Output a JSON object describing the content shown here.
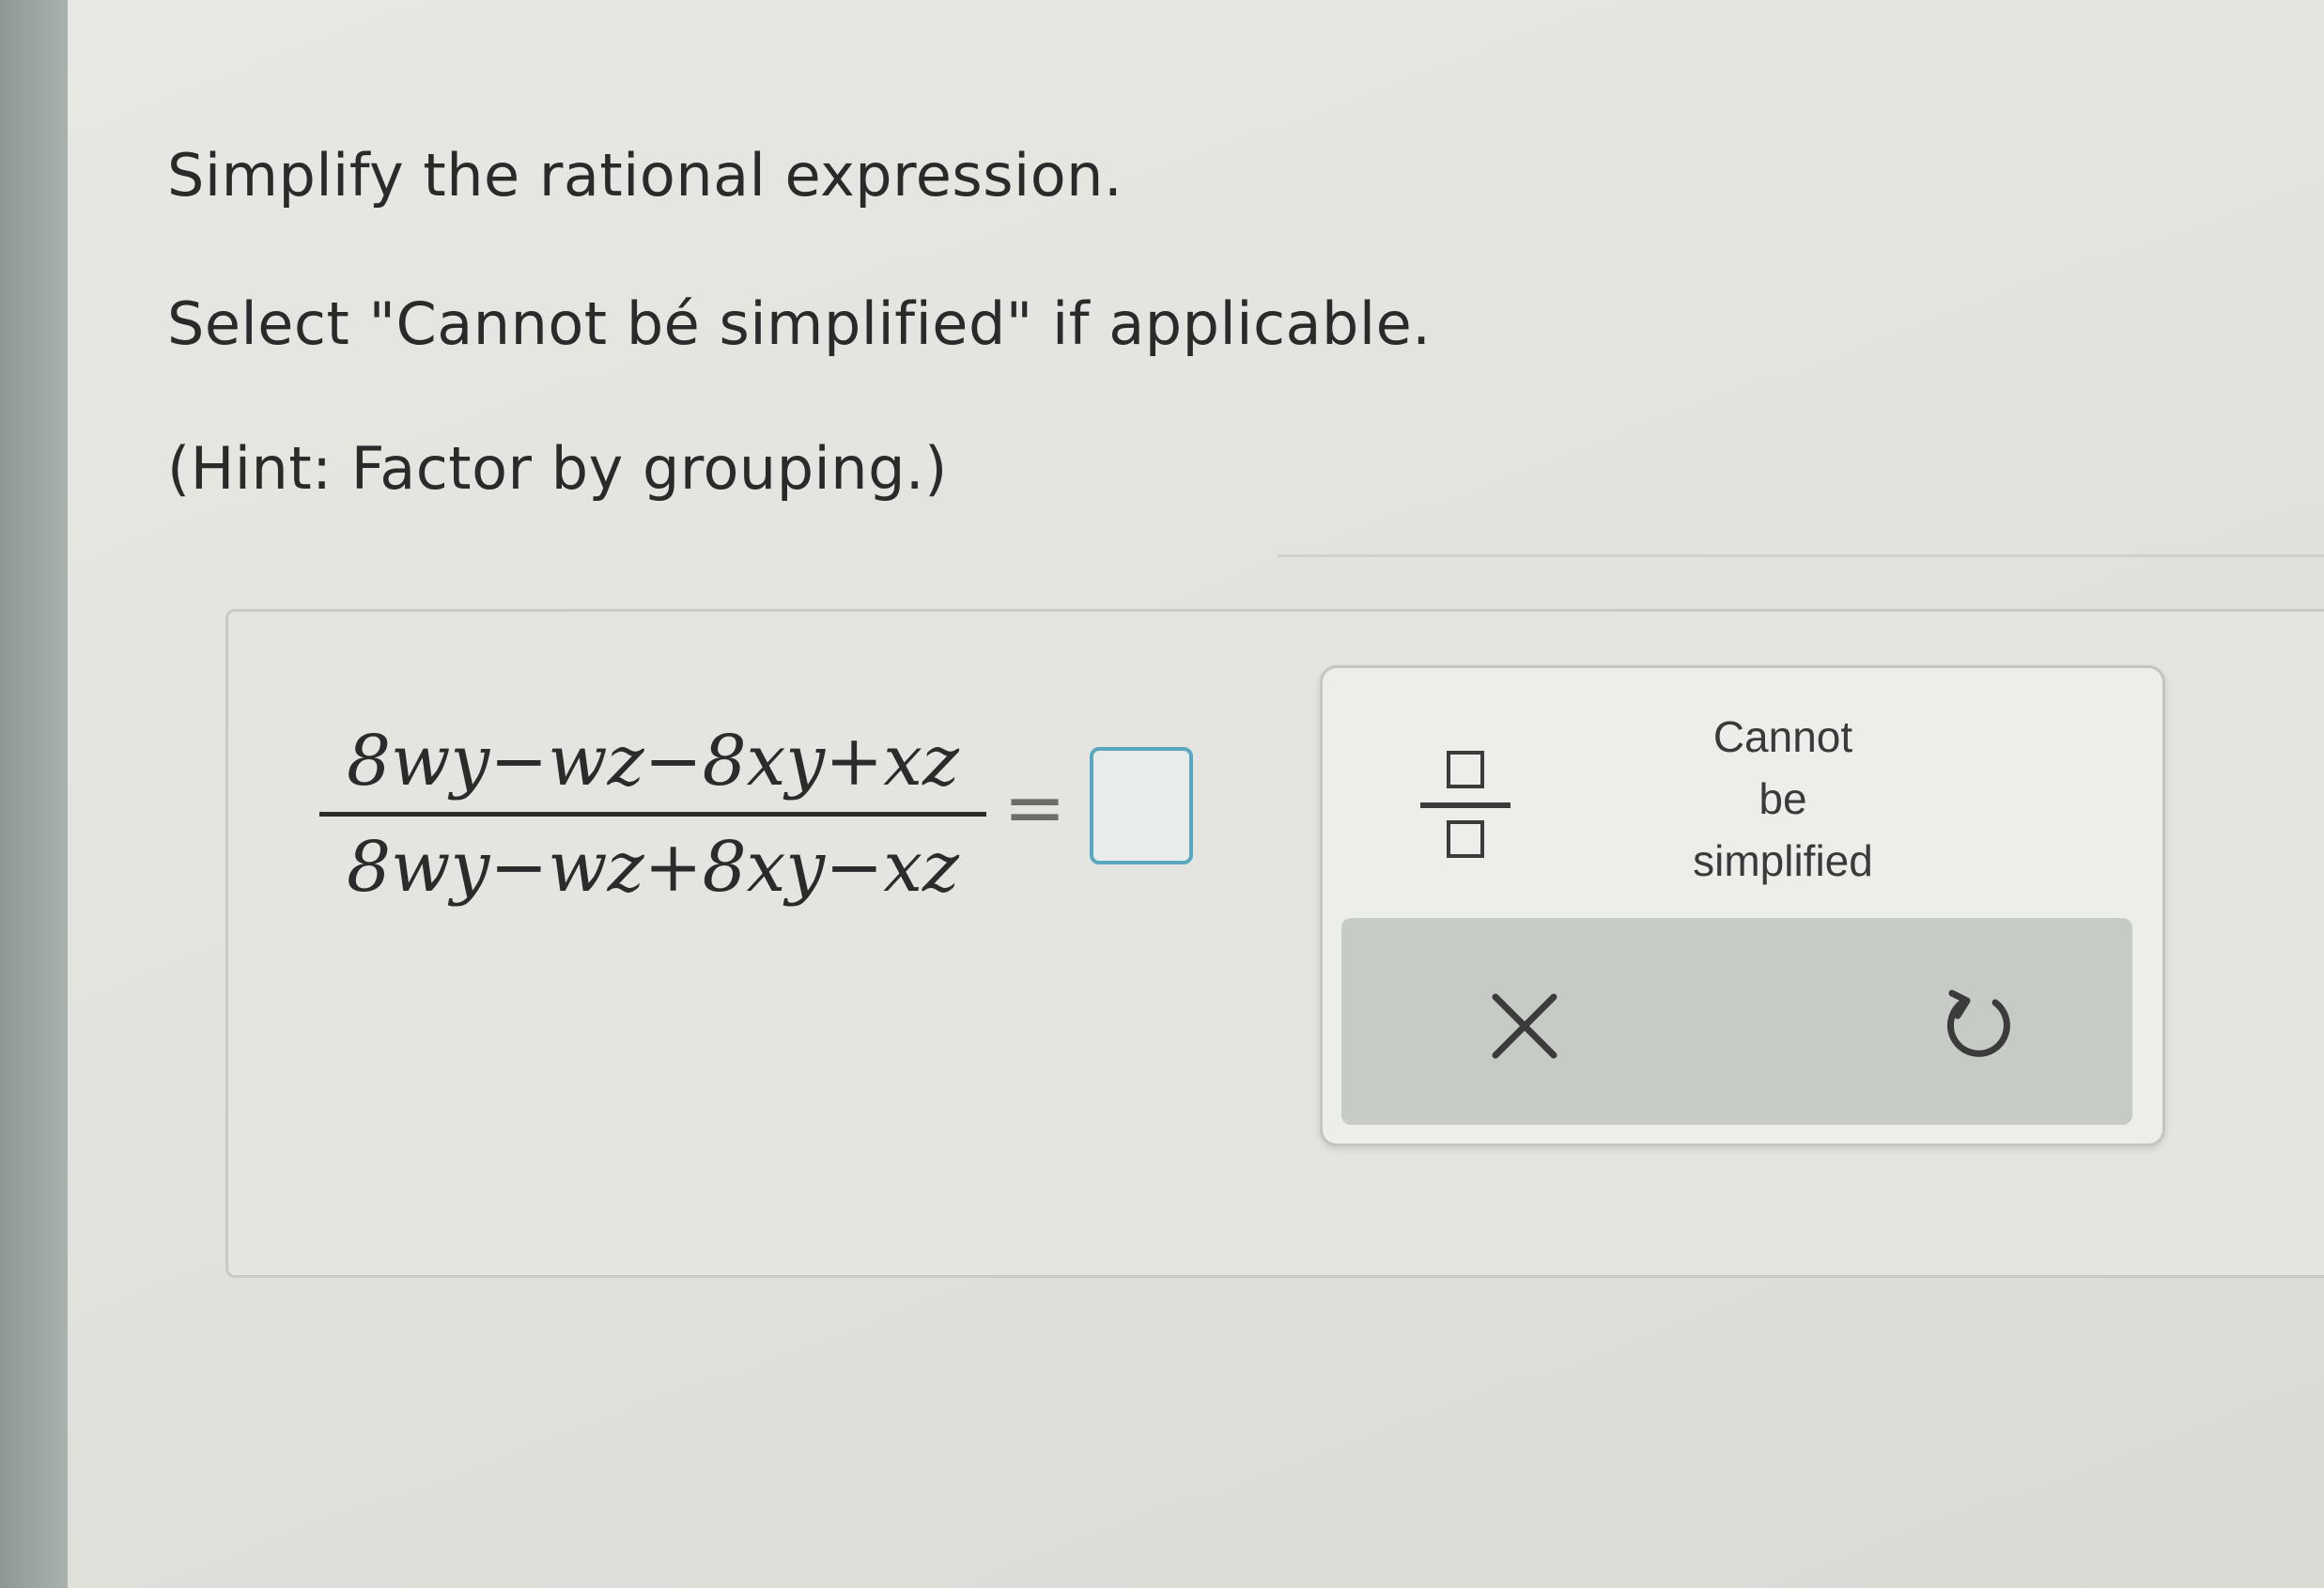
{
  "question": {
    "line1": "Simplify the rational expression.",
    "line2": "Select \"Cannot bé simplified\" if applicable.",
    "line3": "(Hint: Factor by grouping.)"
  },
  "expression": {
    "numerator": "8wy−wz−8xy+xz",
    "denominator": "8wy−wz+8xy−xz",
    "equals": "="
  },
  "answer": {
    "value": ""
  },
  "keypad": {
    "fraction_icon": "fraction-template-icon",
    "cannot_label": "Cannot\nbe\nsimplified",
    "clear_icon": "x-icon",
    "undo_icon": "undo-icon"
  },
  "colors": {
    "answer_border": "#5aa8bf",
    "action_bar": "#c7cbc6"
  }
}
